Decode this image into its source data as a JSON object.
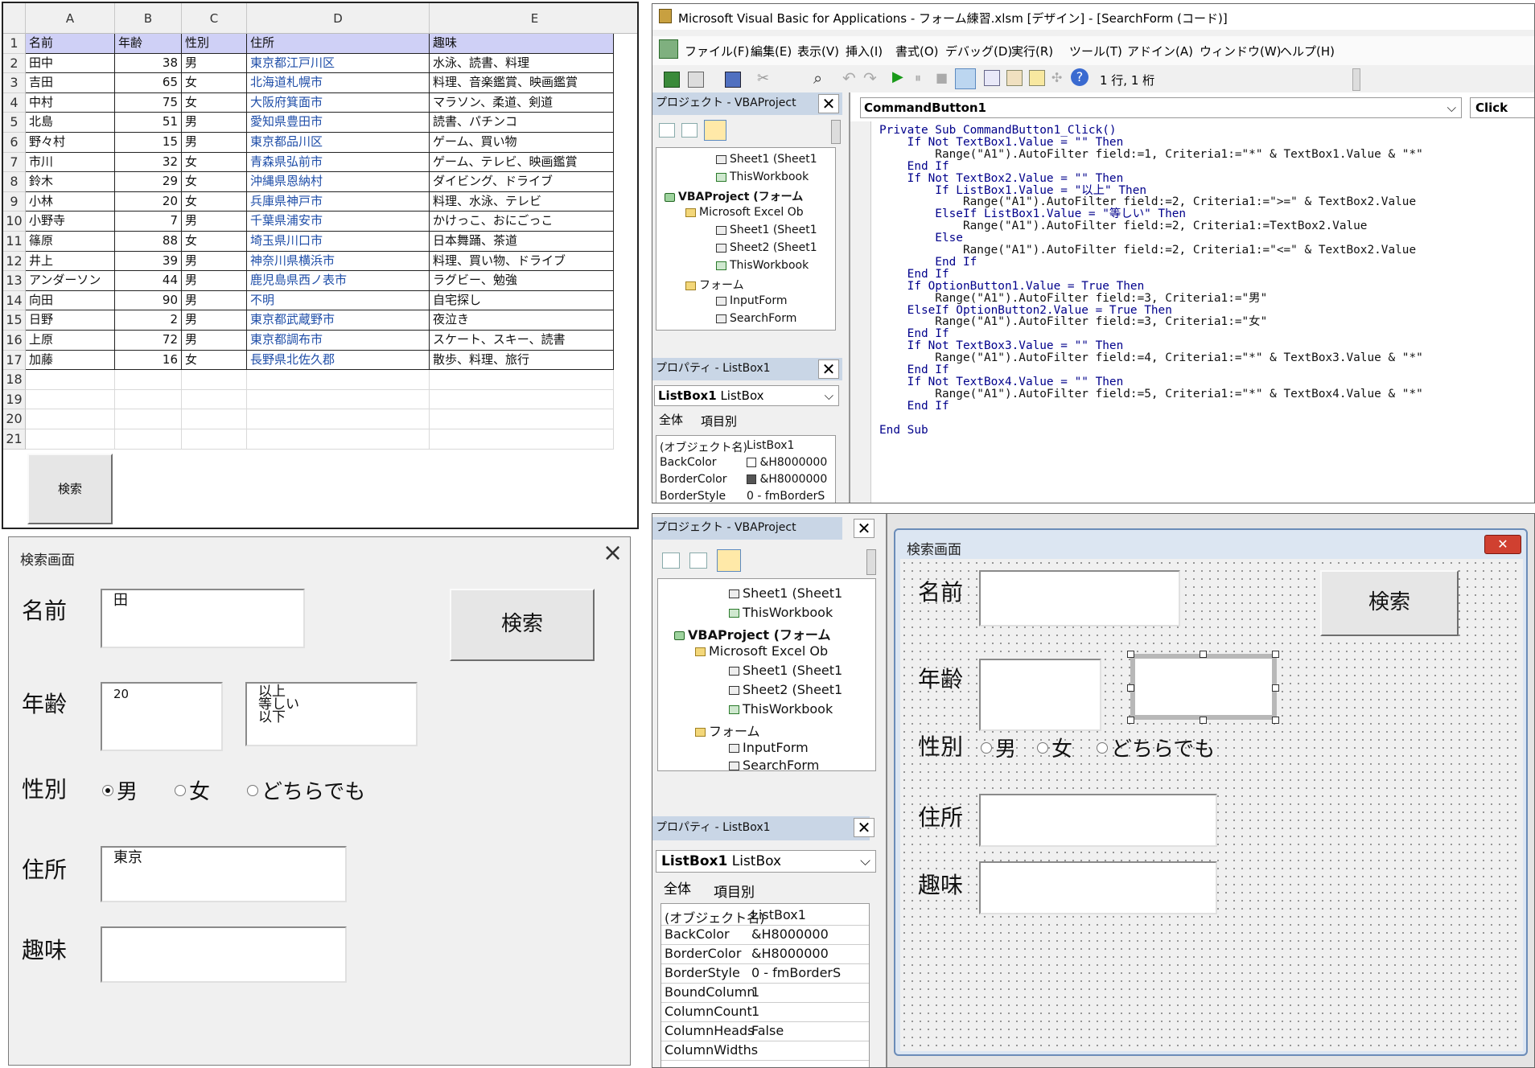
{
  "excel": {
    "columns": [
      "A",
      "B",
      "C",
      "D",
      "E"
    ],
    "row_numbers": [
      "1",
      "2",
      "3",
      "4",
      "5",
      "6",
      "7",
      "8",
      "9",
      "10",
      "11",
      "12",
      "13",
      "14",
      "15",
      "16",
      "17",
      "18",
      "19",
      "20",
      "21"
    ],
    "header": [
      "名前",
      "年齢",
      "性別",
      "住所",
      "趣味"
    ],
    "rows": [
      [
        "田中",
        "38",
        "男",
        "東京都江戸川区",
        "水泳、読書、料理"
      ],
      [
        "吉田",
        "65",
        "女",
        "北海道札幌市",
        "料理、音楽鑑賞、映画鑑賞"
      ],
      [
        "中村",
        "75",
        "女",
        "大阪府箕面市",
        "マラソン、柔道、剣道"
      ],
      [
        "北島",
        "51",
        "男",
        "愛知県豊田市",
        "読書、パチンコ"
      ],
      [
        "野々村",
        "15",
        "男",
        "東京都品川区",
        "ゲーム、買い物"
      ],
      [
        "市川",
        "32",
        "女",
        "青森県弘前市",
        "ゲーム、テレビ、映画鑑賞"
      ],
      [
        "鈴木",
        "29",
        "女",
        "沖縄県恩納村",
        "ダイビング、ドライブ"
      ],
      [
        "小林",
        "20",
        "女",
        "兵庫県神戸市",
        "料理、水泳、テレビ"
      ],
      [
        "小野寺",
        "7",
        "男",
        "千葉県浦安市",
        "かけっこ、おにごっこ"
      ],
      [
        "篠原",
        "88",
        "女",
        "埼玉県川口市",
        "日本舞踊、茶道"
      ],
      [
        "井上",
        "39",
        "男",
        "神奈川県横浜市",
        "料理、買い物、ドライブ"
      ],
      [
        "アンダーソン",
        "44",
        "男",
        "鹿児島県西ノ表市",
        "ラグビー、勉強"
      ],
      [
        "向田",
        "90",
        "男",
        "不明",
        "自宅探し"
      ],
      [
        "日野",
        "2",
        "男",
        "東京都武蔵野市",
        "夜泣き"
      ],
      [
        "上原",
        "72",
        "男",
        "東京都調布市",
        "スケート、スキー、読書"
      ],
      [
        "加藤",
        "16",
        "女",
        "長野県北佐久郡",
        "散歩、料理、旅行"
      ]
    ],
    "search_button": "検索"
  },
  "userform": {
    "title": "検索画面",
    "close": "×",
    "labels": {
      "name": "名前",
      "age": "年齢",
      "sex": "性別",
      "address": "住所",
      "hobby": "趣味"
    },
    "name_value": "田",
    "age_value": "20",
    "age_options": [
      "以上",
      "等しい",
      "以下"
    ],
    "sex_options": [
      "男",
      "女",
      "どちらでも"
    ],
    "sex_selected": "男",
    "address_value": "東京",
    "hobby_value": "",
    "search_button": "検索"
  },
  "vba": {
    "title": "Microsoft Visual Basic for Applications - フォーム練習.xlsm [デザイン] - [SearchForm (コード)]",
    "menu": [
      "ファイル(F)",
      "編集(E)",
      "表示(V)",
      "挿入(I)",
      "書式(O)",
      "デバッグ(D)",
      "実行(R)",
      "ツール(T)",
      "アドイン(A)",
      "ウィンドウ(W)",
      "ヘルプ(H)"
    ],
    "toolbar_position": "1 行, 1 桁",
    "project_panel_title": "プロジェクト - VBAProject",
    "tree": [
      "Sheet1 (Sheet1",
      "ThisWorkbook",
      "VBAProject (フォーム",
      "Microsoft Excel Ob",
      "Sheet1 (Sheet1",
      "Sheet2 (Sheet1",
      "ThisWorkbook",
      "フォーム",
      "InputForm",
      "SearchForm"
    ],
    "properties_title": "プロパティ - ListBox1",
    "object_select_name": "ListBox1",
    "object_select_type": "ListBox",
    "prop_tabs": [
      "全体",
      "項目別"
    ],
    "props": [
      [
        "(オブジェクト名)",
        "ListBox1"
      ],
      [
        "BackColor",
        "&H8000000"
      ],
      [
        "BorderColor",
        "&H8000000"
      ],
      [
        "BorderStyle",
        "0 - fmBorderS"
      ]
    ],
    "object_dropdown": "CommandButton1",
    "proc_dropdown": "Click",
    "code_lines": [
      "Private Sub CommandButton1_Click()",
      "    If Not TextBox1.Value = \"\" Then",
      "        Range(\"A1\").AutoFilter field:=1, Criteria1:=\"*\" & TextBox1.Value & \"*\"",
      "    End If",
      "    If Not TextBox2.Value = \"\" Then",
      "        If ListBox1.Value = \"以上\" Then",
      "            Range(\"A1\").AutoFilter field:=2, Criteria1:=\">=\" & TextBox2.Value",
      "        ElseIf ListBox1.Value = \"等しい\" Then",
      "            Range(\"A1\").AutoFilter field:=2, Criteria1:=TextBox2.Value",
      "        Else",
      "            Range(\"A1\").AutoFilter field:=2, Criteria1:=\"<=\" & TextBox2.Value",
      "        End If",
      "    End If",
      "    If OptionButton1.Value = True Then",
      "        Range(\"A1\").AutoFilter field:=3, Criteria1:=\"男\"",
      "    ElseIf OptionButton2.Value = True Then",
      "        Range(\"A1\").AutoFilter field:=3, Criteria1:=\"女\"",
      "    End If",
      "    If Not TextBox3.Value = \"\" Then",
      "        Range(\"A1\").AutoFilter field:=4, Criteria1:=\"*\" & TextBox3.Value & \"*\"",
      "    End If",
      "    If Not TextBox4.Value = \"\" Then",
      "        Range(\"A1\").AutoFilter field:=5, Criteria1:=\"*\" & TextBox4.Value & \"*\"",
      "    End If",
      "",
      "End Sub"
    ]
  },
  "designer": {
    "project_panel_title": "プロジェクト - VBAProject",
    "tree": [
      "Sheet1 (Sheet1",
      "ThisWorkbook",
      "VBAProject (フォーム",
      "Microsoft Excel Ob",
      "Sheet1 (Sheet1",
      "Sheet2 (Sheet1",
      "ThisWorkbook",
      "フォーム",
      "InputForm",
      "SearchForm"
    ],
    "properties_title": "プロパティ - ListBox1",
    "object_select_name": "ListBox1",
    "object_select_type": "ListBox",
    "prop_tabs": [
      "全体",
      "項目別"
    ],
    "props": [
      [
        "(オブジェクト名)",
        "ListBox1"
      ],
      [
        "BackColor",
        "&H8000000"
      ],
      [
        "BorderColor",
        "&H8000000"
      ],
      [
        "BorderStyle",
        "0 - fmBorderS"
      ],
      [
        "BoundColumn",
        "1"
      ],
      [
        "ColumnCount",
        "1"
      ],
      [
        "ColumnHeads",
        "False"
      ],
      [
        "ColumnWidths",
        ""
      ]
    ],
    "form_title": "検索画面",
    "labels": {
      "name": "名前",
      "age": "年齢",
      "sex": "性別",
      "address": "住所",
      "hobby": "趣味"
    },
    "sex_options": [
      "男",
      "女",
      "どちらでも"
    ],
    "search_button": "検索"
  }
}
